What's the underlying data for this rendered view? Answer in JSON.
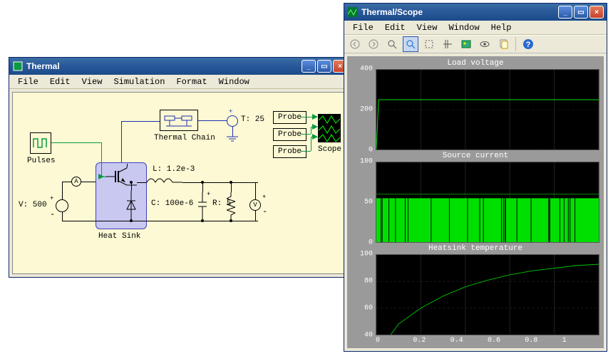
{
  "thermal_window": {
    "title": "Thermal",
    "menus": [
      "File",
      "Edit",
      "View",
      "Simulation",
      "Format",
      "Window"
    ],
    "blocks": {
      "pulses": "Pulses",
      "thermal_chain": "Thermal Chain",
      "heat_sink": "Heat Sink",
      "t_source": "T: 25",
      "v_source": "V: 500",
      "inductor": "L: 1.2e-3",
      "capacitor": "C: 100e-6",
      "resistor": "R: 5",
      "probe1": "Probe",
      "probe2": "Probe",
      "probe3": "Probe",
      "scope": "Scope"
    }
  },
  "scope_window": {
    "title": "Thermal/Scope",
    "menus": [
      "File",
      "Edit",
      "View",
      "Window",
      "Help"
    ],
    "toolbar_icons": [
      "back-icon",
      "forward-icon",
      "zoom-in-icon",
      "zoom-area-icon",
      "zoom-fit-icon",
      "cursor-icon",
      "image-icon",
      "eye-icon",
      "copy-icon",
      "sep",
      "help-icon"
    ],
    "plot_titles": [
      "Load voltage",
      "Source current",
      "Heatsink temperature"
    ]
  },
  "chart_data": [
    {
      "type": "line",
      "title": "Load voltage",
      "xlabel": "",
      "ylabel": "",
      "xlim": [
        0,
        1
      ],
      "ylim": [
        0,
        400
      ],
      "yticks": [
        0,
        200,
        400
      ],
      "x": [
        0,
        0.01,
        0.02,
        1
      ],
      "values": [
        0,
        250,
        250,
        250
      ]
    },
    {
      "type": "line",
      "title": "Source current",
      "xlabel": "",
      "ylabel": "",
      "xlim": [
        0,
        1
      ],
      "ylim": [
        0,
        100
      ],
      "yticks": [
        0,
        50,
        100
      ],
      "note": "PWM signal oscillating densely between ~0 and ~55",
      "x": [
        0,
        1
      ],
      "values": [
        50,
        50
      ],
      "fill_to_zero": true
    },
    {
      "type": "line",
      "title": "Heatsink temperature",
      "xlabel": "",
      "ylabel": "",
      "xlim": [
        0,
        1
      ],
      "ylim": [
        40,
        100
      ],
      "yticks": [
        40,
        60,
        80,
        100
      ],
      "xticks": [
        0,
        0.2,
        0.4,
        0.6,
        0.8,
        1
      ],
      "x": [
        0,
        0.1,
        0.2,
        0.3,
        0.4,
        0.5,
        0.6,
        0.7,
        0.8,
        0.9,
        1
      ],
      "values": [
        25,
        48,
        60,
        69,
        76,
        81,
        85,
        88,
        90,
        92,
        93
      ]
    }
  ]
}
